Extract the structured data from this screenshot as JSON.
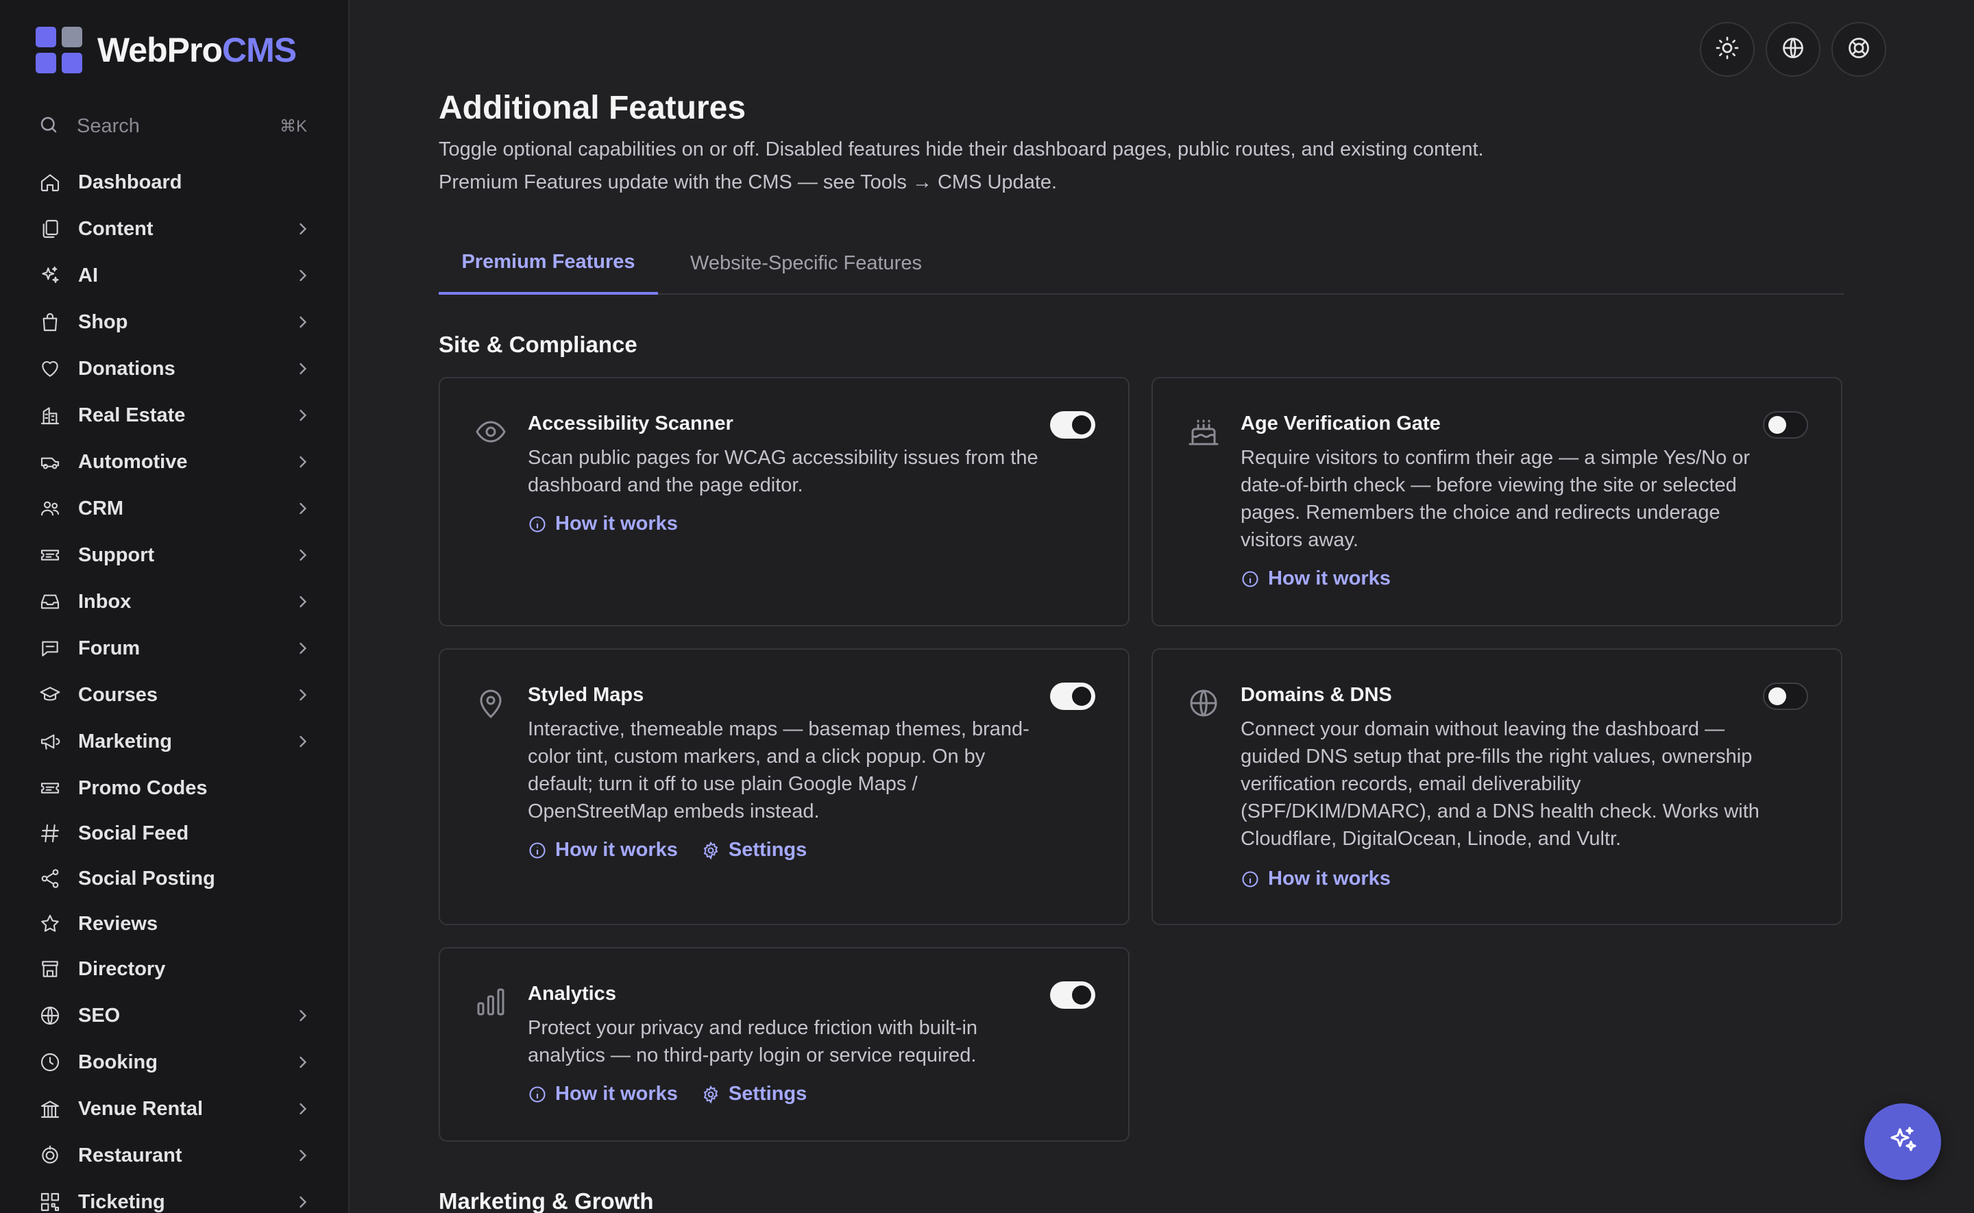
{
  "brand": {
    "name_part1": "WebPro",
    "name_part2": "CMS",
    "accent": "#7b7ff5"
  },
  "search": {
    "placeholder": "Search",
    "shortcut": "⌘K",
    "icon": "search-icon"
  },
  "sidebar": {
    "items": [
      {
        "label": "Dashboard",
        "icon": "home-icon",
        "has_children": false
      },
      {
        "label": "Content",
        "icon": "pages-icon",
        "has_children": true
      },
      {
        "label": "AI",
        "icon": "sparkles-icon",
        "has_children": true
      },
      {
        "label": "Shop",
        "icon": "shopping-bag-icon",
        "has_children": true
      },
      {
        "label": "Donations",
        "icon": "heart-icon",
        "has_children": true
      },
      {
        "label": "Real Estate",
        "icon": "building-icon",
        "has_children": true
      },
      {
        "label": "Automotive",
        "icon": "car-icon",
        "has_children": true
      },
      {
        "label": "CRM",
        "icon": "users-icon",
        "has_children": true
      },
      {
        "label": "Support",
        "icon": "ticket-icon",
        "has_children": true
      },
      {
        "label": "Inbox",
        "icon": "inbox-icon",
        "has_children": true
      },
      {
        "label": "Forum",
        "icon": "chat-icon",
        "has_children": true
      },
      {
        "label": "Courses",
        "icon": "graduation-cap-icon",
        "has_children": true
      },
      {
        "label": "Marketing",
        "icon": "megaphone-icon",
        "has_children": true
      },
      {
        "label": "Promo Codes",
        "icon": "ticket-icon",
        "has_children": false
      },
      {
        "label": "Social Feed",
        "icon": "hash-icon",
        "has_children": false
      },
      {
        "label": "Social Posting",
        "icon": "share-icon",
        "has_children": false
      },
      {
        "label": "Reviews",
        "icon": "star-icon",
        "has_children": false
      },
      {
        "label": "Directory",
        "icon": "store-icon",
        "has_children": false
      },
      {
        "label": "SEO",
        "icon": "globe-icon",
        "has_children": true
      },
      {
        "label": "Booking",
        "icon": "clock-icon",
        "has_children": true
      },
      {
        "label": "Venue Rental",
        "icon": "venue-icon",
        "has_children": true
      },
      {
        "label": "Restaurant",
        "icon": "restaurant-icon",
        "has_children": true
      },
      {
        "label": "Ticketing",
        "icon": "qr-icon",
        "has_children": true
      }
    ]
  },
  "topbar": {
    "buttons": [
      "sun-icon",
      "globe-icon",
      "help-icon"
    ]
  },
  "page": {
    "title": "Additional Features",
    "description_line1": "Toggle optional capabilities on or off. Disabled features hide their dashboard pages, public routes, and existing content.",
    "description_line2": "Premium Features update with the CMS — see Tools → CMS Update."
  },
  "tabs": [
    {
      "label": "Premium Features",
      "active": true
    },
    {
      "label": "Website-Specific Features",
      "active": false
    }
  ],
  "sections": [
    {
      "title": "Site & Compliance"
    },
    {
      "title": "Marketing & Growth"
    }
  ],
  "features": [
    {
      "title": "Accessibility Scanner",
      "icon": "eye-icon",
      "enabled": true,
      "description": "Scan public pages for WCAG accessibility issues from the dashboard and the page editor.",
      "how_it_works": "How it works",
      "settings": null
    },
    {
      "title": "Age Verification Gate",
      "icon": "cake-icon",
      "enabled": false,
      "description": "Require visitors to confirm their age — a simple Yes/No or date-of-birth check — before viewing the site or selected pages. Remembers the choice and redirects underage visitors away.",
      "how_it_works": "How it works",
      "settings": null
    },
    {
      "title": "Styled Maps",
      "icon": "map-pin-icon",
      "enabled": true,
      "description": "Interactive, themeable maps — basemap themes, brand-color tint, custom markers, and a click popup. On by default; turn it off to use plain Google Maps / OpenStreetMap embeds instead.",
      "how_it_works": "How it works",
      "settings": "Settings"
    },
    {
      "title": "Domains & DNS",
      "icon": "globe-icon",
      "enabled": false,
      "description": "Connect your domain without leaving the dashboard — guided DNS setup that pre-fills the right values, ownership verification records, email deliverability (SPF/DKIM/DMARC), and a DNS health check. Works with Cloudflare, DigitalOcean, Linode, and Vultr.",
      "how_it_works": "How it works",
      "settings": null
    },
    {
      "title": "Analytics",
      "icon": "bar-chart-icon",
      "enabled": true,
      "description": "Protect your privacy and reduce friction with built-in analytics — no third-party login or service required.",
      "how_it_works": "How it works",
      "settings": "Settings"
    }
  ],
  "fab": {
    "icon": "ai-sparkles-icon",
    "color": "#5b5fd6"
  }
}
